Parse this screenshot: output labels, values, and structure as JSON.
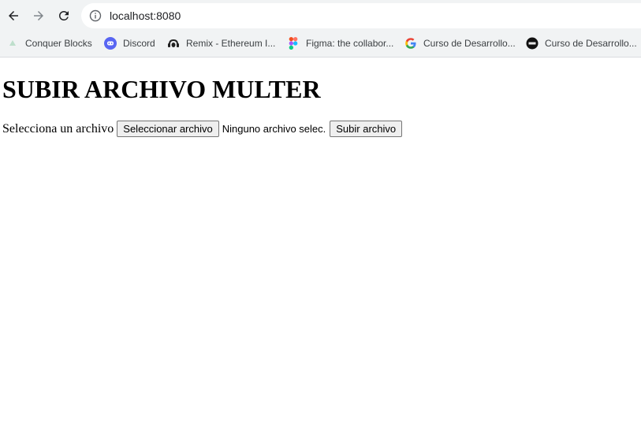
{
  "browser": {
    "url": "localhost:8080",
    "bookmarks": [
      {
        "label": "Conquer Blocks",
        "icon": "conquer-blocks-icon"
      },
      {
        "label": "Discord",
        "icon": "discord-icon"
      },
      {
        "label": "Remix - Ethereum I...",
        "icon": "remix-icon"
      },
      {
        "label": "Figma: the collabor...",
        "icon": "figma-icon"
      },
      {
        "label": "Curso de Desarrollo...",
        "icon": "google-icon"
      },
      {
        "label": "Curso de Desarrollo...",
        "icon": "codigo-facilito-icon"
      }
    ]
  },
  "page": {
    "title": "SUBIR ARCHIVO MULTER",
    "form": {
      "label": "Selecciona un archivo",
      "choose_button": "Seleccionar archivo",
      "file_status": "Ninguno archivo selec.",
      "submit_button": "Subir archivo"
    }
  }
}
